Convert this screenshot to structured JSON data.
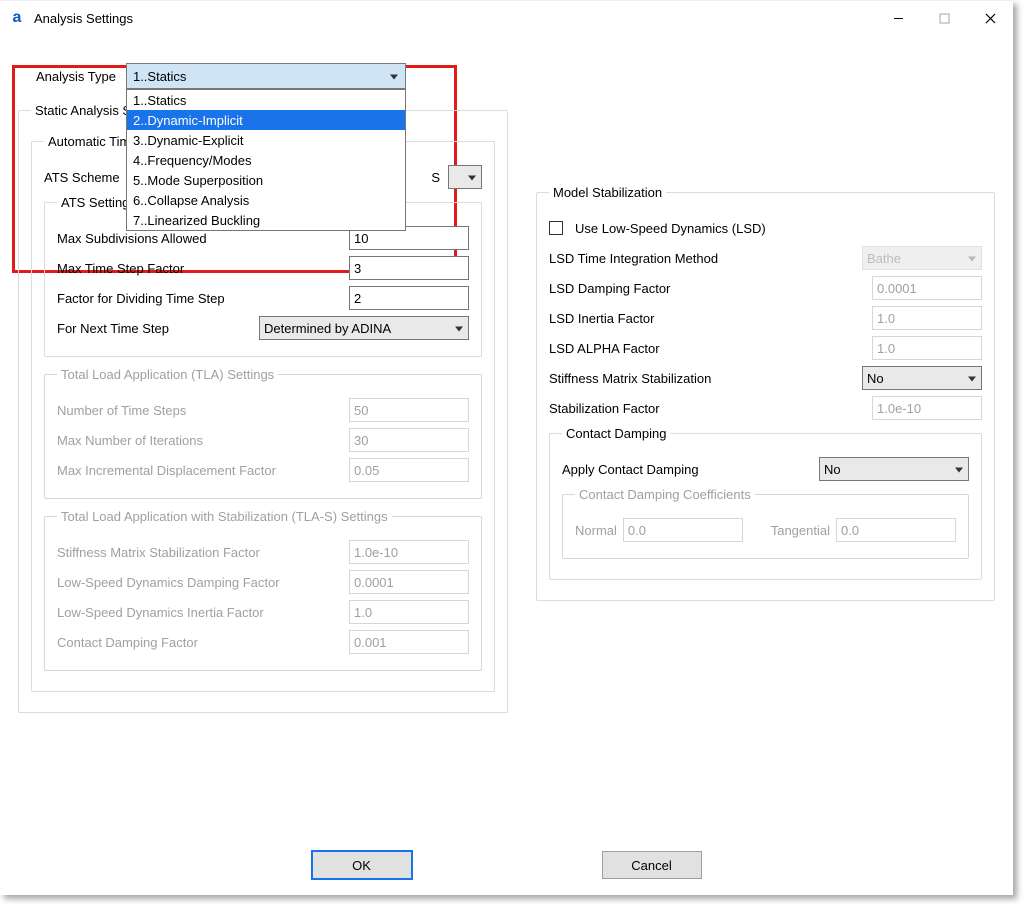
{
  "window": {
    "title": "Analysis Settings"
  },
  "analysisType": {
    "label": "Analysis Type",
    "selected": "1..Statics",
    "options": {
      "o1": "1..Statics",
      "o2": "2..Dynamic-Implicit",
      "o3": "3..Dynamic-Explicit",
      "o4": "4..Frequency/Modes",
      "o5": "5..Mode Superposition",
      "o6": "6..Collapse Analysis",
      "o7": "7..Linearized Buckling"
    }
  },
  "static": {
    "legend": "Static Analysis Set",
    "autoTime": {
      "legend": "Automatic Time"
    },
    "atsSchemeLabel": "ATS Scheme",
    "atsSchemeTail": "S",
    "atsSettings": {
      "legend": "ATS Settings",
      "maxSubLabel": "Max Subdivisions Allowed",
      "maxSubVal": "10",
      "maxTsfLabel": "Max Time Step Factor",
      "maxTsfVal": "3",
      "factorDivLabel": "Factor for Dividing Time Step",
      "factorDivVal": "2",
      "nextStepLabel": "For Next Time Step",
      "nextStepVal": "Determined by ADINA"
    },
    "tla": {
      "legend": "Total Load Application (TLA) Settings",
      "numStepsLabel": "Number of Time Steps",
      "numStepsVal": "50",
      "maxIterLabel": "Max Number of Iterations",
      "maxIterVal": "30",
      "maxDispLabel": "Max Incremental Displacement Factor",
      "maxDispVal": "0.05"
    },
    "tlas": {
      "legend": "Total Load Application with Stabilization (TLA-S) Settings",
      "stiffLabel": "Stiffness Matrix Stabilization Factor",
      "stiffVal": "1.0e-10",
      "lsdDampLabel": "Low-Speed Dynamics Damping Factor",
      "lsdDampVal": "0.0001",
      "lsdInertiaLabel": "Low-Speed Dynamics Inertia Factor",
      "lsdInertiaVal": "1.0",
      "cdfLabel": "Contact Damping Factor",
      "cdfVal": "0.001"
    }
  },
  "modelStab": {
    "legend": "Model Stabilization",
    "useLsdLabel": "Use Low-Speed Dynamics (LSD)",
    "lsdMethodLabel": "LSD Time Integration Method",
    "lsdMethodVal": "Bathe",
    "lsdDampLabel": "LSD Damping Factor",
    "lsdDampVal": "0.0001",
    "lsdInertiaLabel": "LSD Inertia Factor",
    "lsdInertiaVal": "1.0",
    "lsdAlphaLabel": "LSD ALPHA Factor",
    "lsdAlphaVal": "1.0",
    "stiffStabLabel": "Stiffness Matrix Stabilization",
    "stiffStabVal": "No",
    "stabFactorLabel": "Stabilization Factor",
    "stabFactorVal": "1.0e-10",
    "contactDamping": {
      "legend": "Contact Damping",
      "applyLabel": "Apply Contact Damping",
      "applyVal": "No",
      "coeffLegend": "Contact Damping Coefficients",
      "normalLabel": "Normal",
      "normalVal": "0.0",
      "tangentialLabel": "Tangential",
      "tangentialVal": "0.0"
    }
  },
  "buttons": {
    "ok": "OK",
    "cancel": "Cancel"
  }
}
